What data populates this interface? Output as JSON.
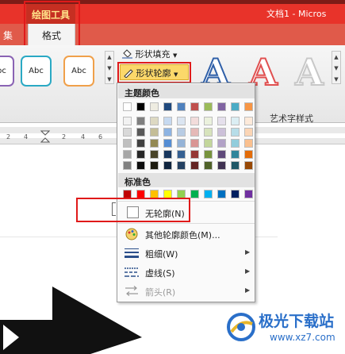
{
  "titlebar": {
    "context_group": "绘图工具",
    "document_title": "文档1 - Micros"
  },
  "tabs": {
    "left_partial": "集",
    "format": "格式"
  },
  "ribbon": {
    "style_box_label": "Abc",
    "shape_fill": "形状填充",
    "shape_outline": "形状轮廓",
    "wordart_letter": "A",
    "wordart_group": "艺术字样式"
  },
  "ruler": {
    "numbers": [
      "2",
      "4",
      "2",
      "4",
      "6"
    ]
  },
  "dropdown": {
    "theme_colors_label": "主题颜色",
    "standard_colors_label": "标准色",
    "no_outline": "无轮廓(N)",
    "more_colors": "其他轮廓颜色(M)...",
    "weight": "粗细(W)",
    "dashes": "虚线(S)",
    "arrows": "箭头(R)"
  },
  "colors": {
    "theme_top": [
      "#ffffff",
      "#000000",
      "#eeece1",
      "#1f497d",
      "#4f81bd",
      "#c0504d",
      "#9bbb59",
      "#8064a2",
      "#4bacc6",
      "#f79646"
    ],
    "theme_columns": [
      [
        "#f2f2f2",
        "#d9d9d9",
        "#bfbfbf",
        "#a6a6a6",
        "#808080"
      ],
      [
        "#7f7f7f",
        "#595959",
        "#404040",
        "#262626",
        "#0d0d0d"
      ],
      [
        "#ddd9c3",
        "#c4bd97",
        "#938953",
        "#494429",
        "#1d1b10"
      ],
      [
        "#c6d9f0",
        "#8db3e2",
        "#548dd4",
        "#17365d",
        "#0f243e"
      ],
      [
        "#dbe5f1",
        "#b8cce4",
        "#95b3d7",
        "#366092",
        "#244061"
      ],
      [
        "#f2dcdb",
        "#e5b9b7",
        "#d99694",
        "#953734",
        "#632423"
      ],
      [
        "#ebf1dd",
        "#d7e3bc",
        "#c3d69b",
        "#76923c",
        "#4f6128"
      ],
      [
        "#e5e0ec",
        "#ccc1d9",
        "#b2a2c7",
        "#5f497a",
        "#3f3151"
      ],
      [
        "#dbeef3",
        "#b7dde8",
        "#92cddc",
        "#31859b",
        "#205867"
      ],
      [
        "#fdeada",
        "#fbd5b5",
        "#fac08f",
        "#e36c09",
        "#974806"
      ]
    ],
    "standard": [
      "#c00000",
      "#ff0000",
      "#ffc000",
      "#ffff00",
      "#92d050",
      "#00b050",
      "#00b0f0",
      "#0070c0",
      "#002060",
      "#7030a0"
    ]
  },
  "watermark": {
    "title": "极光下载站",
    "url": "www.xz7.com"
  }
}
